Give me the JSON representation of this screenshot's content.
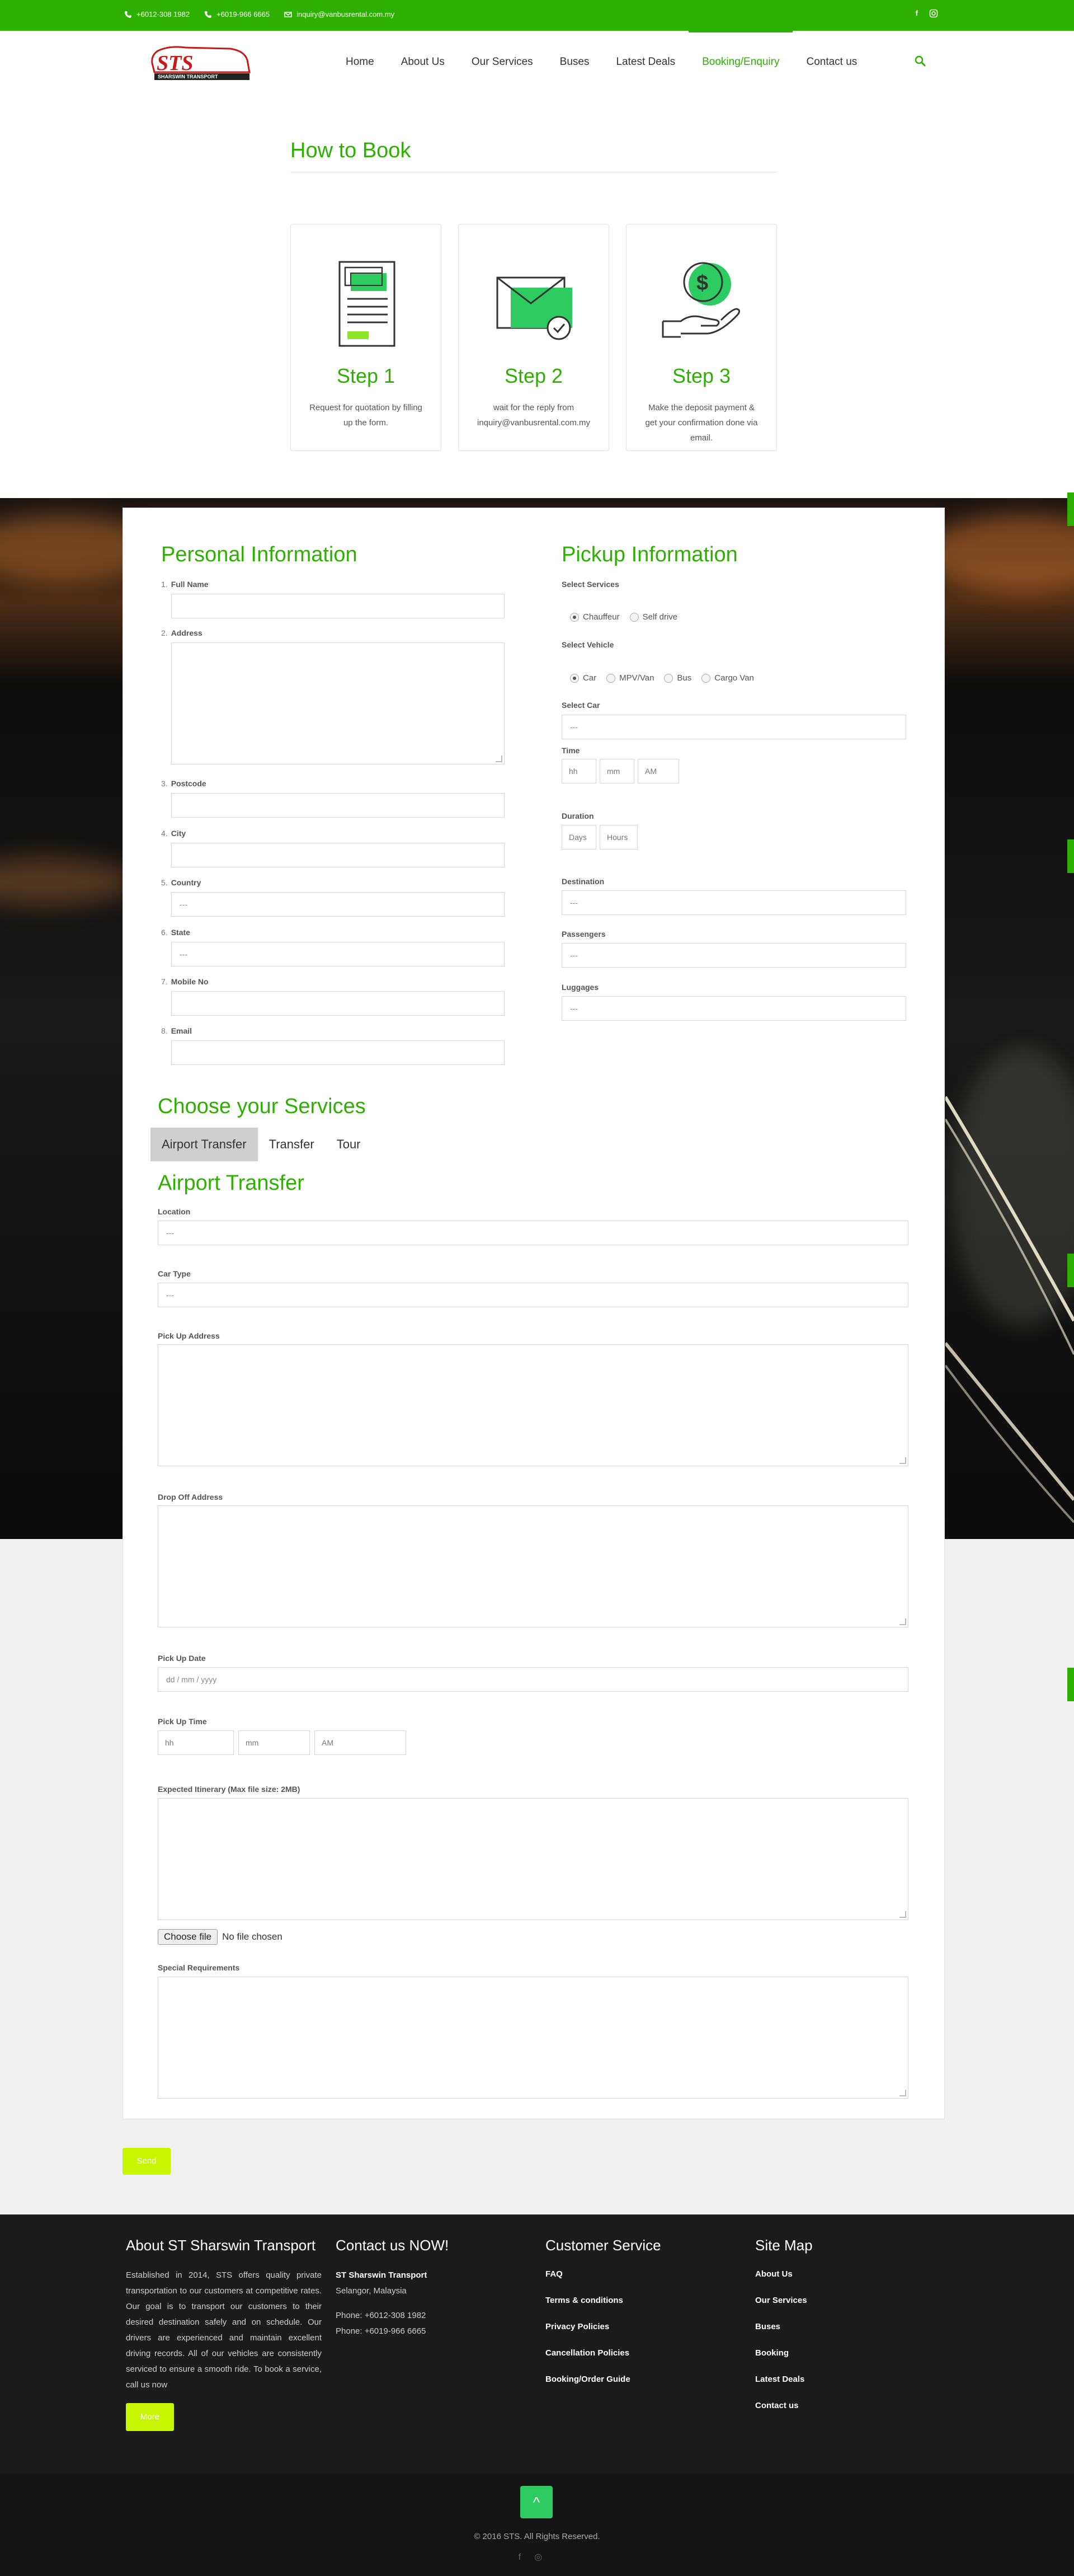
{
  "topbar": {
    "phone1": "+6012-308 1982",
    "phone2": "+6019-966 6665",
    "email": "inquiry@vanbusrental.com.my",
    "social": [
      "f",
      "instagram"
    ]
  },
  "brand": {
    "logo_text": "STS",
    "logo_sub": "SHARSWIN TRANSPORT"
  },
  "nav": {
    "items": [
      "Home",
      "About Us",
      "Our Services",
      "Buses",
      "Latest Deals",
      "Booking/Enquiry",
      "Contact us"
    ],
    "active": "Booking/Enquiry"
  },
  "howto": {
    "title": "How to Book",
    "steps": [
      {
        "title": "Step 1",
        "desc": "Request for quotation by filling up the form."
      },
      {
        "title": "Step 2",
        "desc": "wait for the reply from inquiry@vanbusrental.com.my"
      },
      {
        "title": "Step 3",
        "desc": "Make the deposit payment & get your confirmation done via email."
      }
    ]
  },
  "personal": {
    "title": "Personal Information",
    "fields": [
      {
        "num": "1.",
        "label": "Full Name",
        "value": ""
      },
      {
        "num": "2.",
        "label": "Address",
        "value": ""
      },
      {
        "num": "3.",
        "label": "Postcode",
        "value": ""
      },
      {
        "num": "4.",
        "label": "City",
        "value": ""
      },
      {
        "num": "5.",
        "label": "Country",
        "value": "---"
      },
      {
        "num": "6.",
        "label": "State",
        "value": "---"
      },
      {
        "num": "7.",
        "label": "Mobile No",
        "value": ""
      },
      {
        "num": "8.",
        "label": "Email",
        "value": ""
      }
    ]
  },
  "pickup": {
    "title": "Pickup Information",
    "select_services_label": "Select Services",
    "services": [
      "Chauffeur",
      "Self drive"
    ],
    "select_vehicle_label": "Select Vehicle",
    "vehicles": [
      "Car",
      "MPV/Van",
      "Bus",
      "Cargo Van"
    ],
    "select_car_label": "Select Car",
    "select_car_value": "---",
    "time_label": "Time",
    "time_hh": "hh",
    "time_mm": "mm",
    "time_ampm": "AM",
    "duration_label": "Duration",
    "duration_days": "Days",
    "duration_hours": "Hours",
    "destination_label": "Destination",
    "destination_value": "---",
    "passengers_label": "Passengers",
    "passengers_value": "---",
    "luggages_label": "Luggages",
    "luggages_value": "---"
  },
  "services": {
    "title": "Choose your Services",
    "tabs": [
      "Airport Transfer",
      "Transfer",
      "Tour"
    ],
    "active_tab": "Airport Transfer",
    "section_title": "Airport Transfer",
    "location_label": "Location",
    "location_value": "---",
    "car_type_label": "Car Type",
    "car_type_value": "---",
    "pickup_address_label": "Pick Up Address",
    "dropoff_address_label": "Drop Off Address",
    "pickup_date_label": "Pick Up Date",
    "pickup_date_placeholder": "dd / mm / yyyy",
    "pickup_time_label": "Pick Up Time",
    "pickup_time_hh": "hh",
    "pickup_time_mm": "mm",
    "pickup_time_ampm": "AM",
    "itinerary_label": "Expected Itinerary (Max file size: 2MB)",
    "choose_file": "Choose file",
    "no_file": "No file chosen",
    "special_label": "Special Requirements"
  },
  "send_label": "Send",
  "footer": {
    "about_title": "About ST Sharswin Transport",
    "about_text": "Established in 2014, STS offers quality private transportation to our customers at competitive rates. Our goal is to transport our customers to their desired destination safely and on schedule. Our drivers are experienced and maintain excellent driving records. All of our vehicles are consistently serviced to ensure a smooth ride. To book a service, call us now",
    "more_label": "More",
    "contact_title": "Contact us NOW!",
    "company": "ST Sharswin Transport",
    "location": "Selangor, Malaysia",
    "phone1": "Phone: +6012-308 1982",
    "phone2": "Phone: +6019-966 6665",
    "cs_title": "Customer Service",
    "cs_links": [
      "FAQ",
      "Terms & conditions",
      "Privacy Policies",
      "Cancellation Policies",
      "Booking/Order Guide"
    ],
    "sitemap_title": "Site Map",
    "sitemap_links": [
      "About Us",
      "Our Services",
      "Buses",
      "Booking",
      "Latest Deals",
      "Contact us"
    ],
    "copyright": "© 2016 STS. All Rights Reserved.",
    "totop": "^"
  },
  "colors": {
    "brand_green": "#2eb000",
    "button_lime": "#c8f500",
    "footer_bg": "#1b1b1b"
  }
}
